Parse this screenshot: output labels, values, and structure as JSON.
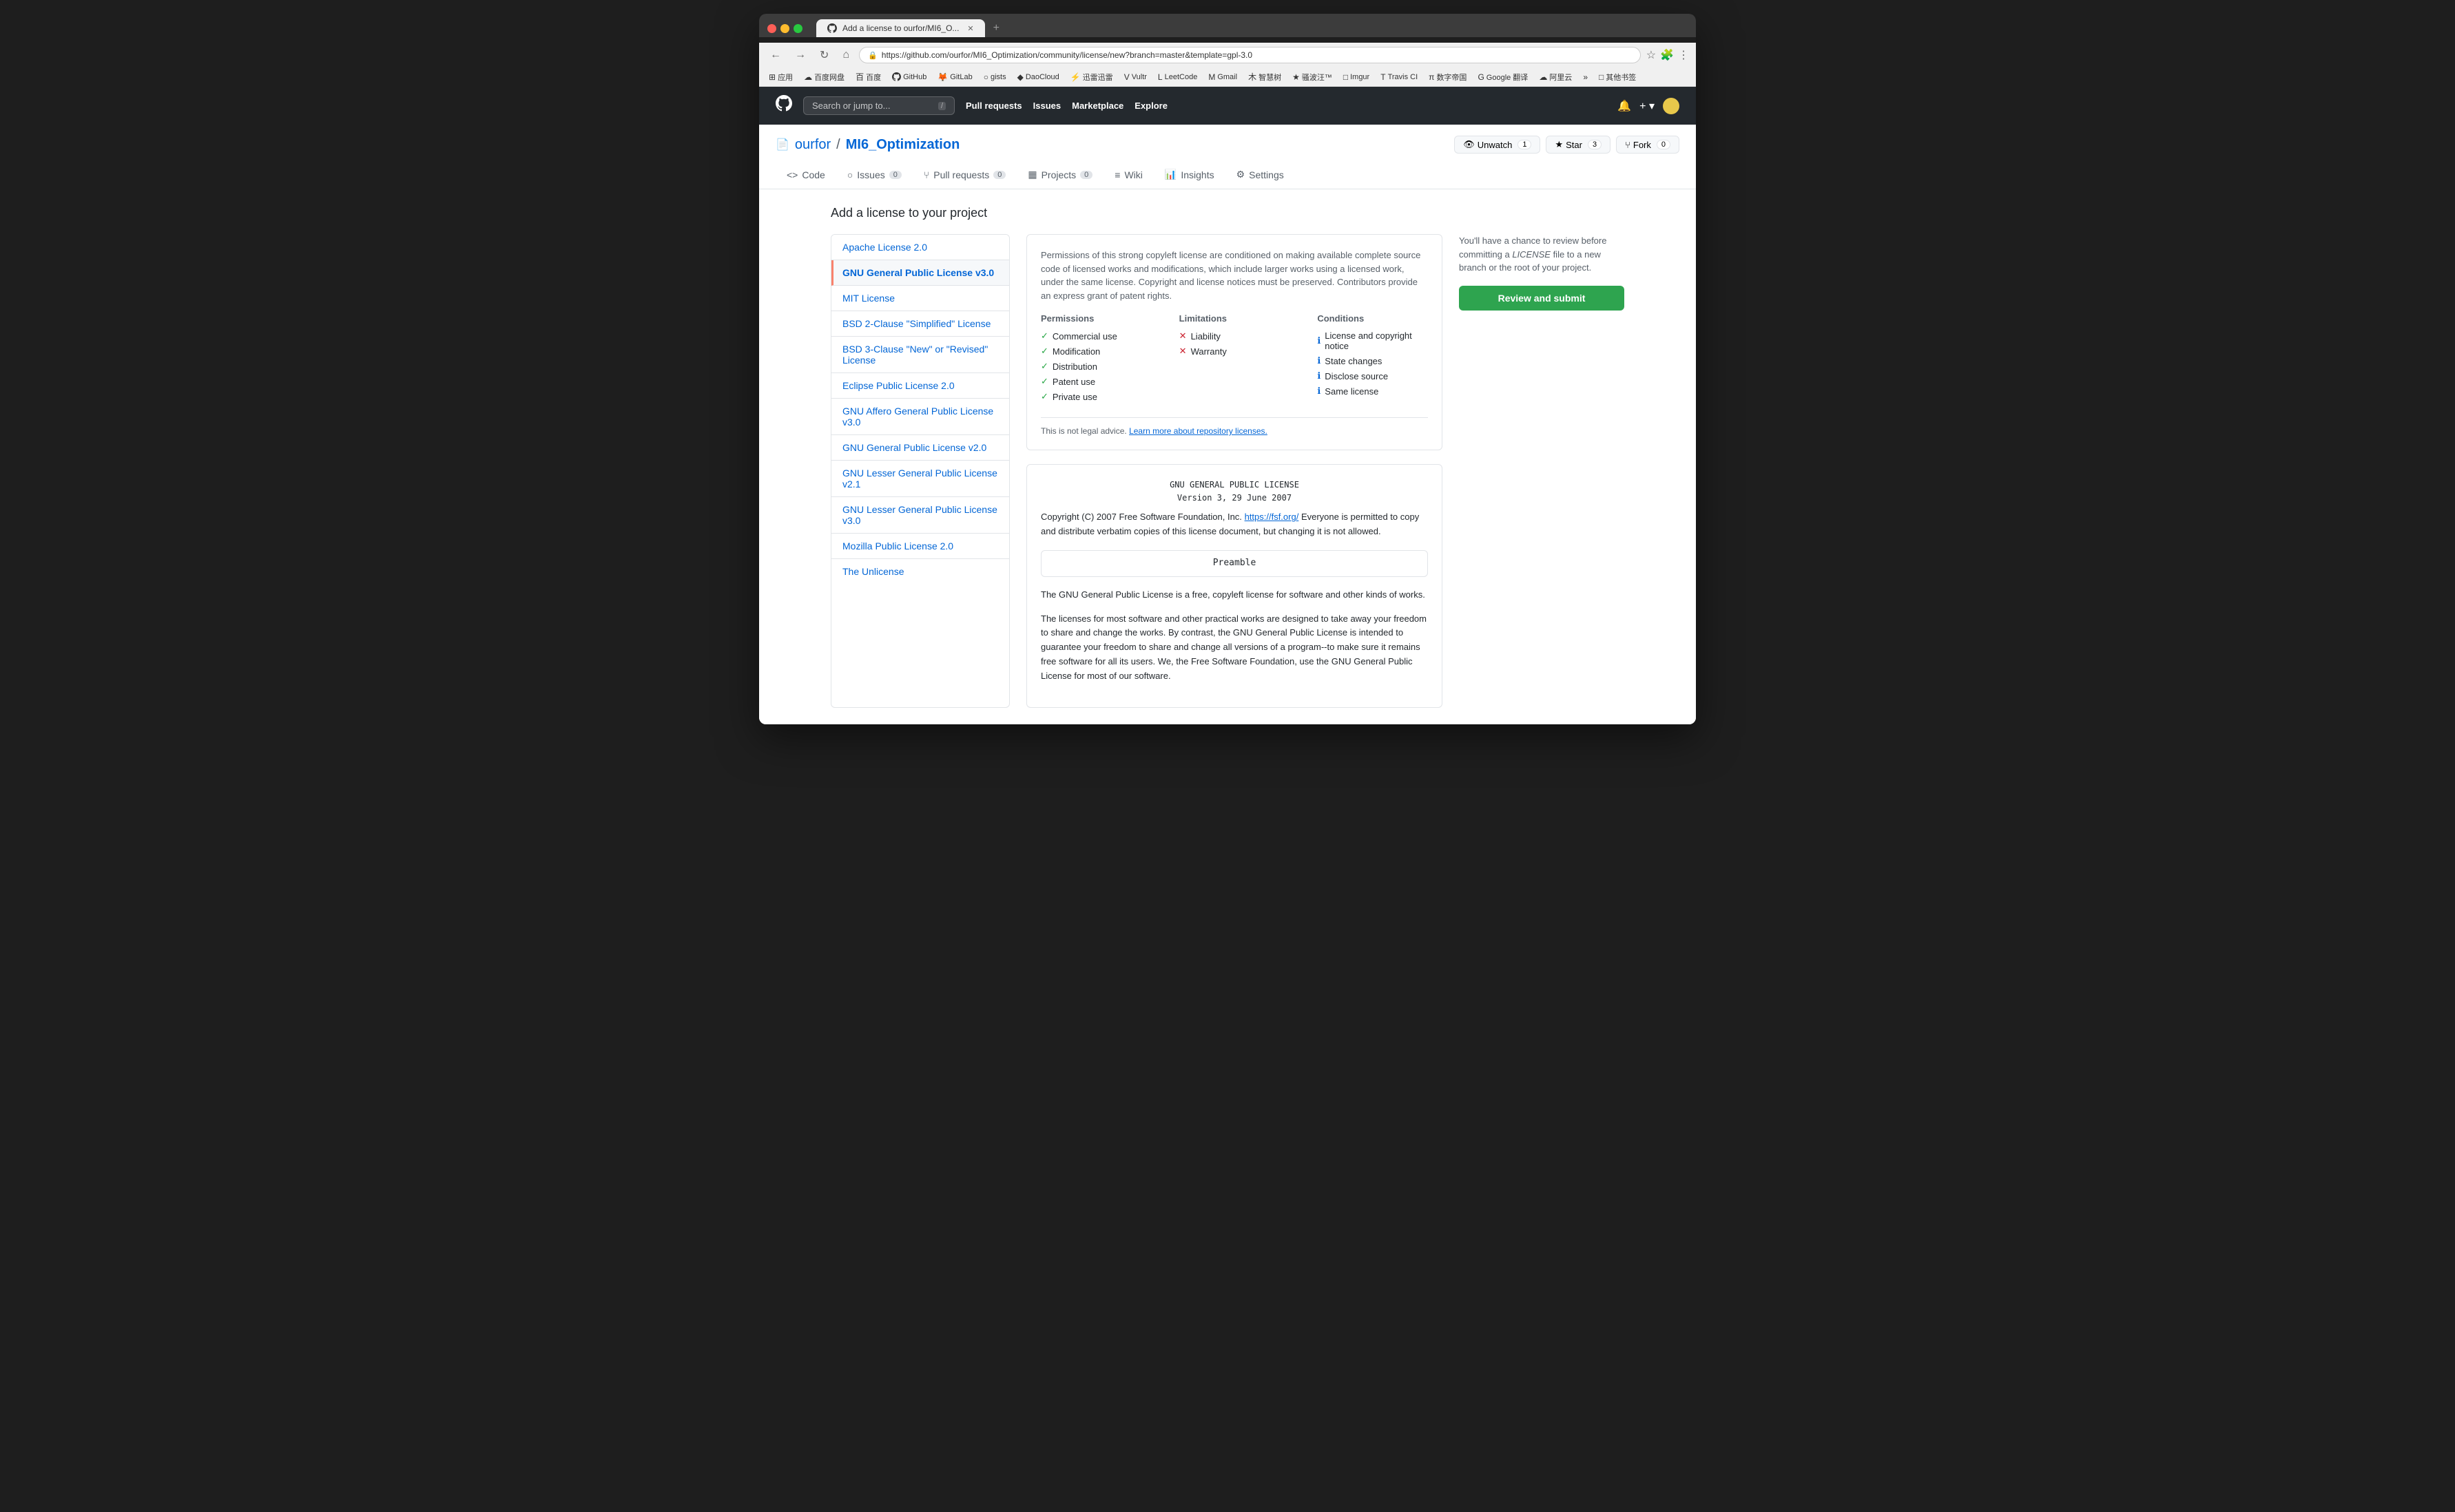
{
  "browser": {
    "tab_title": "Add a license to ourfor/MI6_O...",
    "url": "https://github.com/ourfor/MI6_Optimization/community/license/new?branch=master&template=gpl-3.0",
    "nav_back": "←",
    "nav_forward": "→",
    "nav_refresh": "↻",
    "nav_home": "⌂",
    "bookmarks": [
      {
        "icon": "⊞",
        "label": "应用"
      },
      {
        "icon": "☁",
        "label": "百度网盘"
      },
      {
        "icon": "百",
        "label": "百度"
      },
      {
        "icon": "●",
        "label": "GitHub"
      },
      {
        "icon": "🦊",
        "label": "GitLab"
      },
      {
        "icon": "○",
        "label": "gists"
      },
      {
        "icon": "◆",
        "label": "DaoCloud"
      },
      {
        "icon": "◎",
        "label": "迅雷迅雷"
      },
      {
        "icon": "V",
        "label": "Vultr"
      },
      {
        "icon": "L",
        "label": "LeetCode"
      },
      {
        "icon": "M",
        "label": "Gmail"
      },
      {
        "icon": "木",
        "label": "智慧树"
      },
      {
        "icon": "★",
        "label": "骚波汪™"
      },
      {
        "icon": "□",
        "label": "Imgur"
      },
      {
        "icon": "T",
        "label": "Travis CI"
      },
      {
        "icon": "π",
        "label": "数字帝国"
      },
      {
        "icon": "G",
        "label": "Google 翻译"
      },
      {
        "icon": "☁",
        "label": "阿里云"
      },
      {
        "icon": "»",
        "label": ""
      },
      {
        "icon": "□",
        "label": "其他书签"
      }
    ]
  },
  "github": {
    "search_placeholder": "Search or jump to...",
    "search_shortcut": "/",
    "nav_items": [
      "Pull requests",
      "Issues",
      "Marketplace",
      "Explore"
    ]
  },
  "repo": {
    "owner": "ourfor",
    "name": "MI6_Optimization",
    "icon": "📄",
    "actions": [
      {
        "label": "Unwatch",
        "icon": "👁",
        "count": "1"
      },
      {
        "label": "Star",
        "icon": "★",
        "count": "3"
      },
      {
        "label": "Fork",
        "icon": "⑂",
        "count": "0"
      }
    ],
    "tabs": [
      {
        "label": "Code",
        "icon": "<>",
        "badge": null,
        "active": false
      },
      {
        "label": "Issues",
        "icon": "○",
        "badge": "0",
        "active": false
      },
      {
        "label": "Pull requests",
        "icon": "⑂",
        "badge": "0",
        "active": false
      },
      {
        "label": "Projects",
        "icon": "▦",
        "badge": "0",
        "active": false
      },
      {
        "label": "Wiki",
        "icon": "≡",
        "badge": null,
        "active": false
      },
      {
        "label": "Insights",
        "icon": "📊",
        "badge": null,
        "active": false
      },
      {
        "label": "Settings",
        "icon": "⚙",
        "badge": null,
        "active": false
      }
    ]
  },
  "page": {
    "title": "Add a license to your project"
  },
  "licenses": [
    {
      "id": "apache-2",
      "label": "Apache License 2.0",
      "active": false
    },
    {
      "id": "gpl-3",
      "label": "GNU General Public License v3.0",
      "active": true
    },
    {
      "id": "mit",
      "label": "MIT License",
      "active": false
    },
    {
      "id": "bsd-2",
      "label": "BSD 2-Clause \"Simplified\" License",
      "active": false
    },
    {
      "id": "bsd-3",
      "label": "BSD 3-Clause \"New\" or \"Revised\" License",
      "active": false
    },
    {
      "id": "eclipse",
      "label": "Eclipse Public License 2.0",
      "active": false
    },
    {
      "id": "agpl-3",
      "label": "GNU Affero General Public License v3.0",
      "active": false
    },
    {
      "id": "gpl-2",
      "label": "GNU General Public License v2.0",
      "active": false
    },
    {
      "id": "lgpl-2",
      "label": "GNU Lesser General Public License v2.1",
      "active": false
    },
    {
      "id": "lgpl-3",
      "label": "GNU Lesser General Public License v3.0",
      "active": false
    },
    {
      "id": "mozilla-2",
      "label": "Mozilla Public License 2.0",
      "active": false
    },
    {
      "id": "unlicense",
      "label": "The Unlicense",
      "active": false
    }
  ],
  "license_info": {
    "description": "Permissions of this strong copyleft license are conditioned on making available complete source code of licensed works and modifications, which include larger works using a licensed work, under the same license. Copyright and license notices must be preserved. Contributors provide an express grant of patent rights.",
    "permissions_header": "Permissions",
    "limitations_header": "Limitations",
    "conditions_header": "Conditions",
    "permissions": [
      "Commercial use",
      "Modification",
      "Distribution",
      "Patent use",
      "Private use"
    ],
    "limitations": [
      "Liability",
      "Warranty"
    ],
    "conditions": [
      "License and copyright notice",
      "State changes",
      "Disclose source",
      "Same license"
    ],
    "legal_notice": "This is not legal advice.",
    "learn_more": "Learn more about repository licenses.",
    "learn_more_url": "#"
  },
  "license_text": {
    "header_line1": "GNU GENERAL PUBLIC LICENSE",
    "header_line2": "Version 3, 29 June 2007",
    "copyright": "Copyright (C) 2007 Free Software Foundation, Inc.",
    "fsf_url": "https://fsf.org/",
    "copy_distribute": "Everyone is permitted to copy and distribute verbatim copies of this license document, but changing it is not allowed.",
    "preamble_label": "Preamble",
    "para1": "The GNU General Public License is a free, copyleft license for software and other kinds of works.",
    "para2": "The licenses for most software and other practical works are designed to take away your freedom to share and change the works. By contrast, the GNU General Public License is intended to guarantee your freedom to share and change all versions of a program--to make sure it remains free software for all its users. We, the Free Software Foundation, use the GNU General Public License for most of our software."
  },
  "sidebar": {
    "notice_text": "You'll have a chance to review before committing a ",
    "notice_filename": "LICENSE",
    "notice_text2": " file to a new branch or the root of your project.",
    "review_button": "Review and submit"
  }
}
